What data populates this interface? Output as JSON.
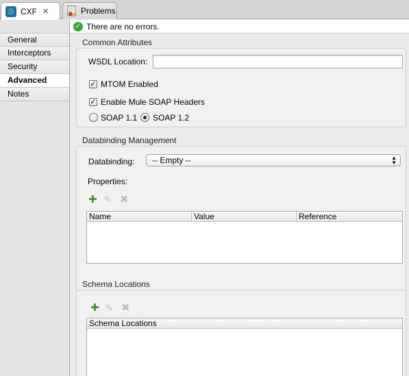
{
  "tabs": [
    {
      "label": "CXF",
      "icon": "globe-icon",
      "active": true
    },
    {
      "label": "Problems",
      "icon": "problems-icon",
      "active": false
    }
  ],
  "status": {
    "text": "There are no errors.",
    "icon": "check-icon"
  },
  "nav": {
    "items": [
      {
        "label": "General"
      },
      {
        "label": "Interceptors"
      },
      {
        "label": "Security"
      },
      {
        "label": "Advanced",
        "selected": true
      },
      {
        "label": "Notes"
      }
    ]
  },
  "common": {
    "title": "Common Attributes",
    "wsdl_label": "WSDL Location:",
    "wsdl_value": "",
    "mtom_label": "MTOM Enabled",
    "mtom_checked": true,
    "mule_soap_label": "Enable Mule SOAP Headers",
    "mule_soap_checked": true,
    "soap11_label": "SOAP 1.1",
    "soap12_label": "SOAP 1.2",
    "soap_selected": "SOAP 1.2"
  },
  "databinding": {
    "title": "Databinding Management",
    "label": "Databinding:",
    "value": "-- Empty --",
    "properties_label": "Properties:",
    "columns": [
      "Name",
      "Value",
      "Reference"
    ]
  },
  "schema": {
    "title": "Schema Locations",
    "columns": [
      "Schema Locations"
    ]
  },
  "colors": {
    "add": "#3c9a2c",
    "disabled": "#bdbdbd",
    "ok": "#3aa53a"
  }
}
